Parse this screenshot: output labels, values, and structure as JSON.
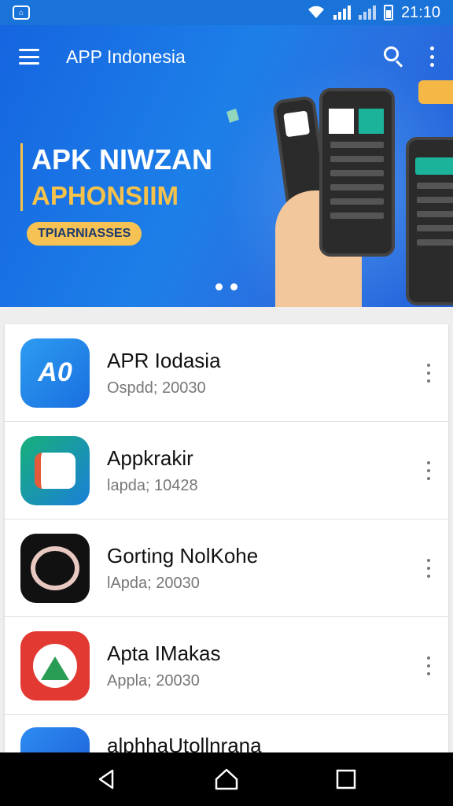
{
  "status_bar": {
    "time": "21:10",
    "notification_icon": "app-notification-icon"
  },
  "app_bar": {
    "title": "APP Indonesia"
  },
  "banner": {
    "headline_line1": "APK NIWZAN",
    "headline_line2": "APHONSIIM",
    "pill_label": "TPIARNIASSES",
    "slide_count": 2,
    "colors": {
      "primary": "#1a73d9",
      "accent": "#f7c24a"
    }
  },
  "apps": [
    {
      "name": "APR Iodasia",
      "subtitle": "Ospdd; 20030",
      "icon": "apr-app-icon"
    },
    {
      "name": "Appkrakir",
      "subtitle": "lapda; 10428",
      "icon": "appkrakir-app-icon"
    },
    {
      "name": "Gorting NolKohe",
      "subtitle": "lApda; 20030",
      "icon": "gorting-app-icon"
    },
    {
      "name": "Apta IMakas",
      "subtitle": "Appla; 20030",
      "icon": "apta-app-icon"
    },
    {
      "name": "alphhaUtollnrana",
      "subtitle": "",
      "icon": "alpha-app-icon"
    }
  ],
  "nav": {
    "back": "back-icon",
    "home": "home-icon",
    "recents": "recents-icon"
  }
}
